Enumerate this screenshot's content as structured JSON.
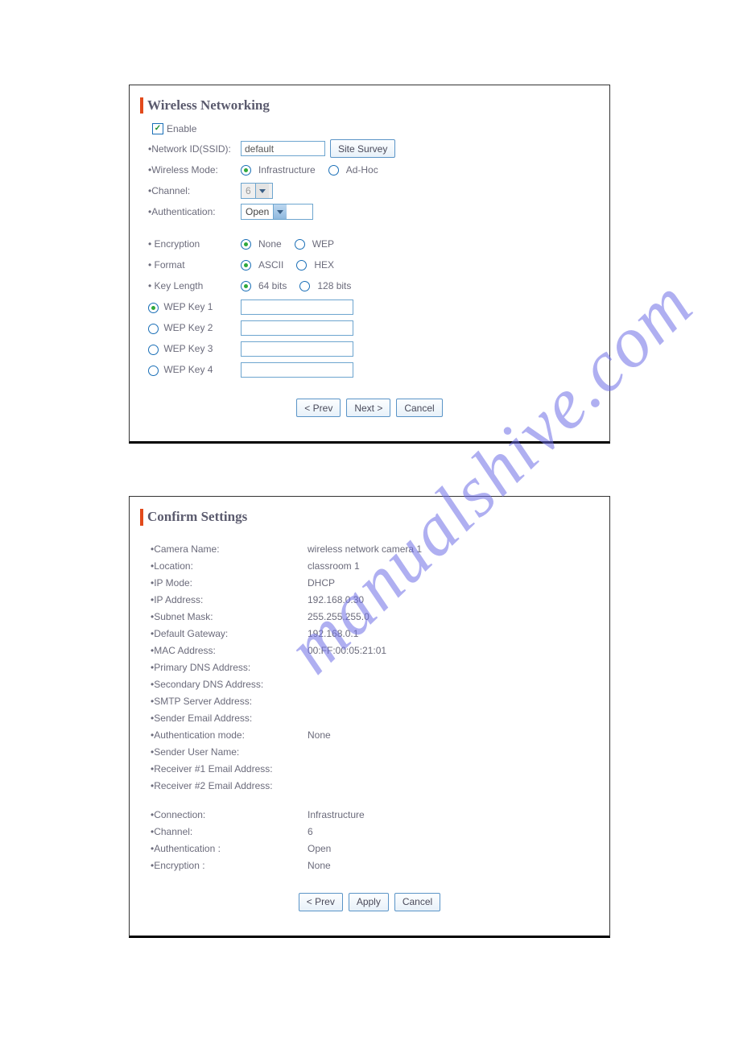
{
  "watermark": "manualshive.com",
  "wireless": {
    "title": "Wireless Networking",
    "enable_label": "Enable",
    "ssid_label": "•Network ID(SSID):",
    "ssid_value": "default",
    "site_survey_btn": "Site Survey",
    "mode_label": "•Wireless Mode:",
    "mode_infra": "Infrastructure",
    "mode_adhoc": "Ad-Hoc",
    "channel_label": "•Channel:",
    "channel_value": "6",
    "auth_label": "•Authentication:",
    "auth_value": "Open",
    "enc_label": "• Encryption",
    "enc_none": "None",
    "enc_wep": "WEP",
    "format_label": "• Format",
    "fmt_ascii": "ASCII",
    "fmt_hex": "HEX",
    "keylen_label": "• Key Length",
    "keylen_64": "64 bits",
    "keylen_128": "128 bits",
    "wep1": "WEP Key 1",
    "wep2": "WEP Key 2",
    "wep3": "WEP Key 3",
    "wep4": "WEP Key 4",
    "prev_btn": "< Prev",
    "next_btn": "Next >",
    "cancel_btn": "Cancel"
  },
  "confirm": {
    "title": "Confirm Settings",
    "rows": {
      "camera_name_l": "•Camera Name:",
      "camera_name_v": "wireless network camera 1",
      "location_l": "•Location:",
      "location_v": "classroom 1",
      "ip_mode_l": "•IP Mode:",
      "ip_mode_v": "DHCP",
      "ip_addr_l": "•IP Address:",
      "ip_addr_v": "192.168.0.30",
      "subnet_l": "•Subnet Mask:",
      "subnet_v": "255.255.255.0",
      "gateway_l": "•Default Gateway:",
      "gateway_v": "192.168.0.1",
      "mac_l": "•MAC Address:",
      "mac_v": "00:FF:00:05:21:01",
      "pdns_l": "•Primary DNS Address:",
      "pdns_v": "",
      "sdns_l": "•Secondary DNS Address:",
      "sdns_v": "",
      "smtp_l": "•SMTP Server Address:",
      "smtp_v": "",
      "sender_email_l": "•Sender Email Address:",
      "sender_email_v": "",
      "auth_mode_l": "•Authentication mode:",
      "auth_mode_v": "None",
      "sender_user_l": "•Sender User Name:",
      "sender_user_v": "",
      "recv1_l": "•Receiver #1 Email Address:",
      "recv1_v": "",
      "recv2_l": "•Receiver #2 Email Address:",
      "recv2_v": "",
      "conn_l": "•Connection:",
      "conn_v": "Infrastructure",
      "chan_l": "•Channel:",
      "chan_v": "6",
      "auth_l": "•Authentication :",
      "auth_v": "Open",
      "enc_l": "•Encryption :",
      "enc_v": "None"
    },
    "prev_btn": "< Prev",
    "apply_btn": "Apply",
    "cancel_btn": "Cancel"
  }
}
